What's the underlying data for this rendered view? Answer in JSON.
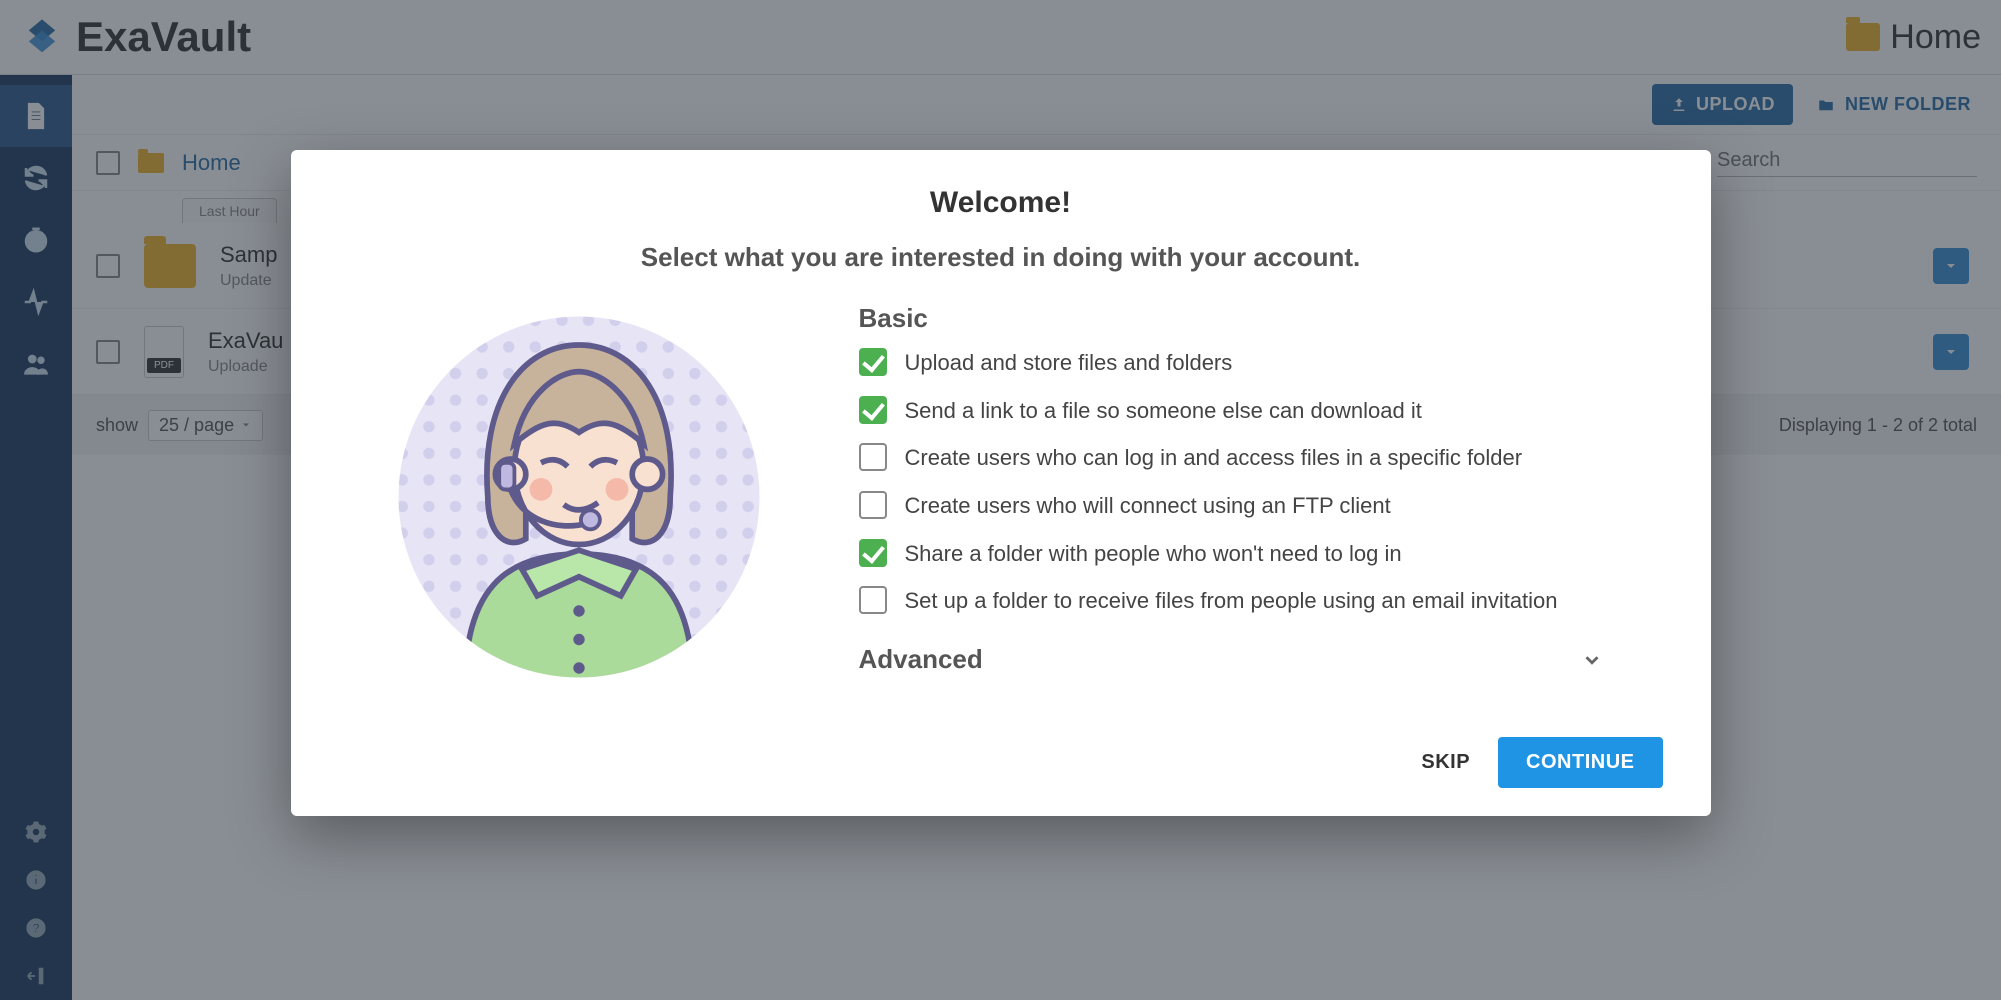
{
  "brand": "ExaVault",
  "top_crumb": "Home",
  "toolbar": {
    "upload_label": "UPLOAD",
    "newfolder_label": "NEW FOLDER"
  },
  "breadcrumb": {
    "label": "Home"
  },
  "search": {
    "placeholder": "Search"
  },
  "tab": "Last Hour",
  "files": [
    {
      "name": "Samp",
      "sub": "Update"
    },
    {
      "name": "ExaVau",
      "sub": "Uploade"
    }
  ],
  "footer": {
    "show_label": "show",
    "per_page": "25 / page",
    "displaying": "Displaying 1 - 2 of 2 total"
  },
  "modal": {
    "title": "Welcome!",
    "subtitle": "Select what you are interested in doing with your account.",
    "basic_label": "Basic",
    "options": [
      {
        "checked": true,
        "text": "Upload and store files and folders"
      },
      {
        "checked": true,
        "text": "Send a link to a file so someone else can download it"
      },
      {
        "checked": false,
        "text": "Create users who can log in and access files in a specific folder"
      },
      {
        "checked": false,
        "text": "Create users who will connect using an FTP client"
      },
      {
        "checked": true,
        "text": "Share a folder with people who won't need to log in"
      },
      {
        "checked": false,
        "text": "Set up a folder to receive files from people using an email invitation"
      }
    ],
    "advanced_label": "Advanced",
    "skip_label": "SKIP",
    "continue_label": "CONTINUE"
  }
}
